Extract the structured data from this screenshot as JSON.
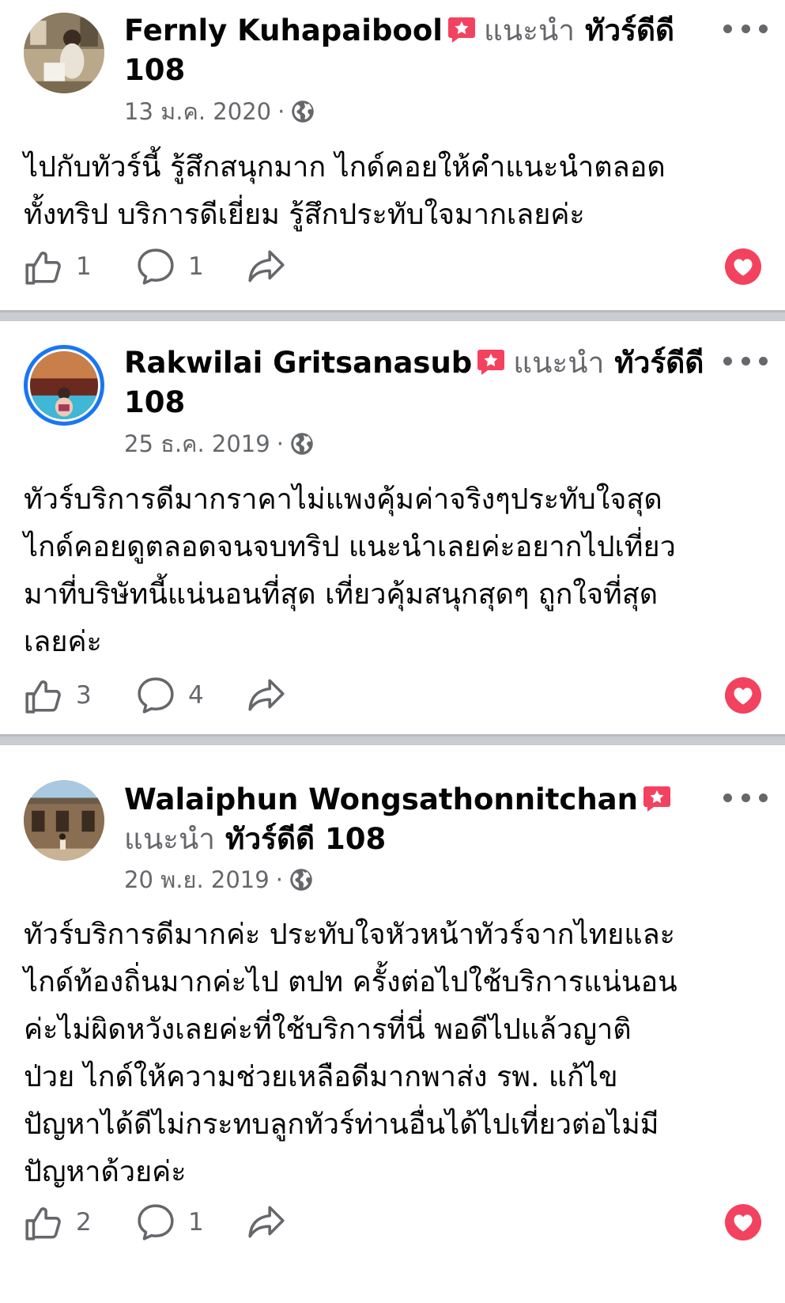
{
  "reviews": [
    {
      "name": "Fernly Kuhapaibool",
      "recommends_label": "แนะนำ",
      "page_name_line1": "ทัวร์ดีดี",
      "page_name_line2": "108",
      "date": "13 ม.ค. 2020",
      "text_lines": [
        "ไปกับทัวร์นี้ รู้สึกสนุกมาก ไกด์คอยให้คำแนะนำตลอด",
        "ทั้งทริป บริการดีเยี่ยม รู้สึกประทับใจมากเลยค่ะ"
      ],
      "likes": "1",
      "comments": "1"
    },
    {
      "name": "Rakwilai Gritsanasub",
      "recommends_label": "แนะนำ",
      "page_name_line1": "ทัวร์ดีดี",
      "page_name_line2": "108",
      "date": "25 ธ.ค. 2019",
      "text_lines": [
        "ทัวร์บริการดีมากราคาไม่แพงคุ้มค่าจริงๆประทับใจสุด",
        "ไกด์คอยดูตลอดจนจบทริป แนะนำเลยค่ะอยากไปเที่ยว",
        "มาที่บริษัทนี้แน่นอนที่สุด เที่ยวคุ้มสนุกสุดๆ ถูกใจที่สุด",
        "เลยค่ะ"
      ],
      "likes": "3",
      "comments": "4"
    },
    {
      "name": "Walaiphun Wongsathonnitchan",
      "recommends_label": "แนะนำ",
      "page_name_line1": "ทัวร์ดีดี 108",
      "date": "20 พ.ย. 2019",
      "text_lines": [
        "ทัวร์บริการดีมากค่ะ ประทับใจหัวหน้าทัวร์จากไทยและ",
        "ไกด์ท้องถิ่นมากค่ะไป ตปท ครั้งต่อไปใช้บริการแน่นอน",
        "ค่ะไม่ผิดหวังเลยค่ะที่ใช้บริการที่นี่ พอดีไปแล้วญาติ",
        "ป่วย ไกด์ให้ความช่วยเหลือดีมากพาส่ง รพ. แก้ไข",
        "ปัญหาได้ดีไม่กระทบลูกทัวร์ท่านอื่นได้ไปเที่ยวต่อไม่มี",
        "ปัญหาด้วยค่ะ"
      ],
      "likes": "2",
      "comments": "1"
    }
  ],
  "separator": "·",
  "icons": {
    "badge": "recommend-badge-icon",
    "globe": "globe-icon",
    "like": "thumbs-up-icon",
    "comment": "comment-icon",
    "share": "share-icon",
    "more": "more-options-icon",
    "heart": "love-reaction-icon"
  },
  "colors": {
    "text": "#050505",
    "secondary": "#65676b",
    "badge": "#f3425f",
    "accent": "#1877f2",
    "divider": "#c9ccd1"
  }
}
